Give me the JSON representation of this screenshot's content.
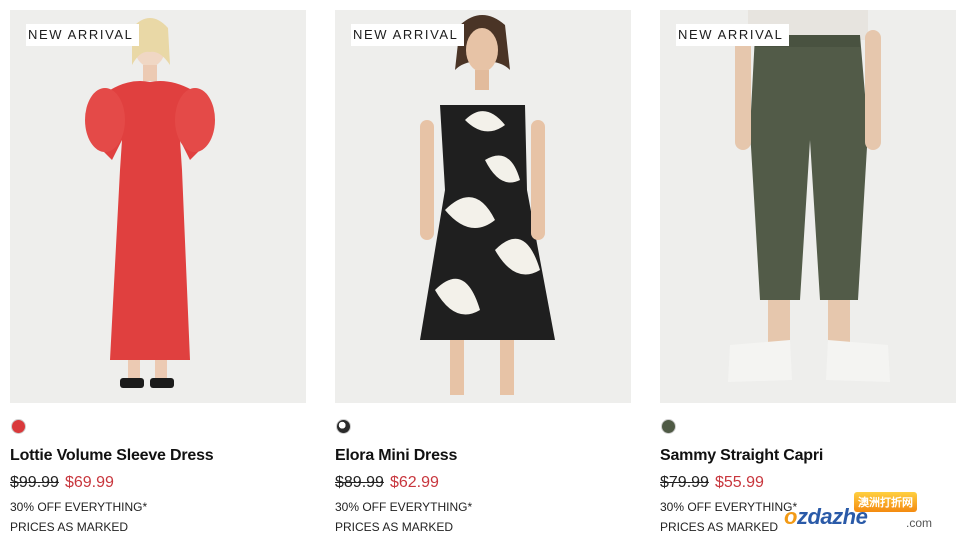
{
  "products": [
    {
      "badge": "NEW ARRIVAL",
      "swatch_color": "#d9393b",
      "name": "Lottie Volume Sleeve Dress",
      "was_price": "$99.99",
      "now_price": "$69.99",
      "promo": "30% OFF EVERYTHING*",
      "note": "PRICES AS MARKED"
    },
    {
      "badge": "NEW ARRIVAL",
      "swatch_color": "#2a2a2a",
      "name": "Elora Mini Dress",
      "was_price": "$89.99",
      "now_price": "$62.99",
      "promo": "30% OFF EVERYTHING*",
      "note": "PRICES AS MARKED"
    },
    {
      "badge": "NEW ARRIVAL",
      "swatch_color": "#4f5a45",
      "name": "Sammy Straight Capri",
      "was_price": "$79.99",
      "now_price": "$55.99",
      "promo": "30% OFF EVERYTHING*",
      "note": "PRICES AS MARKED"
    }
  ],
  "watermark": {
    "cn": "澳洲打折网",
    "o": "o",
    "brand": "zdazhe",
    "com": ".com"
  },
  "colors": {
    "sale_price": "#c8363d",
    "image_bg": "#eeeeec"
  }
}
